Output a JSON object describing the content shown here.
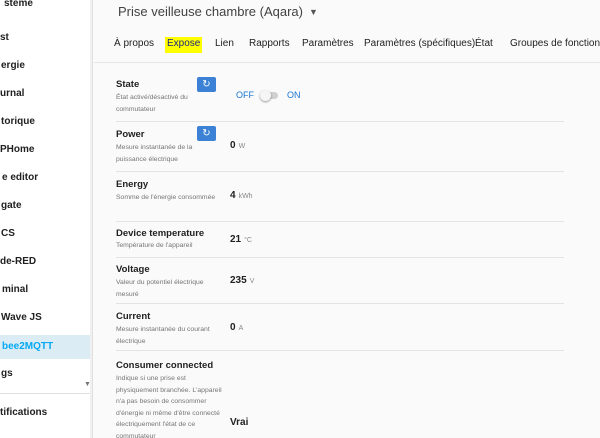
{
  "sidebar": {
    "items": [
      {
        "label": "stème"
      },
      {
        "label": "st"
      },
      {
        "label": "ergie"
      },
      {
        "label": "urnal"
      },
      {
        "label": "torique"
      },
      {
        "label": "PHome"
      },
      {
        "label": "e editor"
      },
      {
        "label": "gate"
      },
      {
        "label": "CS"
      },
      {
        "label": "de-RED"
      },
      {
        "label": "minal"
      },
      {
        "label": "Wave JS"
      },
      {
        "label": "bee2MQTT"
      },
      {
        "label": "gs"
      },
      {
        "label": "tifications"
      }
    ]
  },
  "header": {
    "title": "Prise veilleuse chambre (Aqara)",
    "tabs": [
      {
        "label": "À propos"
      },
      {
        "label": "Expose"
      },
      {
        "label": "Lien"
      },
      {
        "label": "Rapports"
      },
      {
        "label": "Paramètres"
      },
      {
        "label": "Paramètres (spécifiques)"
      },
      {
        "label": "État"
      },
      {
        "label": "Groupes de fonctionnal"
      }
    ]
  },
  "exposes": [
    {
      "name": "State",
      "description": "État activé/désactivé du commutateur",
      "off_label": "OFF",
      "on_label": "ON",
      "state": "off"
    },
    {
      "name": "Power",
      "description": "Mesure instantanée de la puissance électrique",
      "value": "0",
      "unit": "W"
    },
    {
      "name": "Energy",
      "description": "Somme de l'énergie consommée",
      "value": "4",
      "unit": "kWh"
    },
    {
      "name": "Device temperature",
      "description": "Température de l'appareil",
      "value": "21",
      "unit": "°C"
    },
    {
      "name": "Voltage",
      "description": "Valeur du potentiel électrique mesuré",
      "value": "235",
      "unit": "V"
    },
    {
      "name": "Current",
      "description": "Mesure instantanée du courant électrique",
      "value": "0",
      "unit": "A"
    },
    {
      "name": "Consumer connected",
      "description": "Indique si une prise est physiquement branchée. L'appareil n'a pas besoin de consommer d'énergie ni même d'être connecté électriquement l'état de ce commutateur",
      "value": "Vrai"
    }
  ],
  "colors": {
    "accent": "#03a9f4",
    "refresh_button": "#3b82d6",
    "tab_highlight": "#ffff00"
  }
}
